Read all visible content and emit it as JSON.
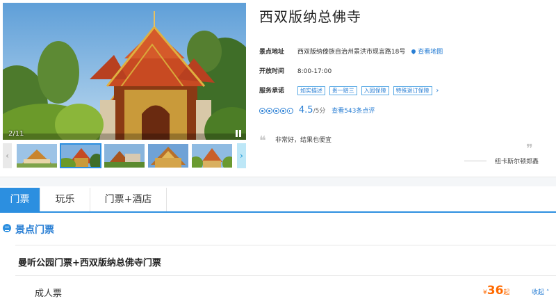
{
  "gallery": {
    "counter": "2/11",
    "thumb_prev": "‹",
    "thumb_next": "›"
  },
  "attraction": {
    "title": "西双版纳总佛寺",
    "address_label": "景点地址",
    "address": "西双版纳傣族自治州景洪市现言路18号",
    "map_link": "查看地图",
    "hours_label": "开放时间",
    "hours": "8:00-17:00",
    "service_label": "服务承诺",
    "service_tags": [
      "如实描述",
      "贵一赔三",
      "入园保障",
      "特殊退订保障"
    ],
    "service_more": "›",
    "score": "4.5",
    "score_max": "/5分",
    "reviews_link": "查看543条点评",
    "quote_open": "❝",
    "quote_text": "非常好，结果也便宜",
    "quote_close": "❞",
    "quote_author": "纽卡斯尔顿郑鑫"
  },
  "tabs": [
    {
      "label": "门票",
      "active": true
    },
    {
      "label": "玩乐",
      "active": false
    },
    {
      "label": "门票+酒店",
      "active": false
    }
  ],
  "tickets": {
    "section_title": "景点门票",
    "package_title": "曼听公园门票+西双版纳总佛寺门票",
    "rows": [
      {
        "label": "成人票",
        "currency": "¥",
        "price": "36",
        "suffix": "起",
        "toggle": "收起"
      }
    ]
  },
  "colors": {
    "accent": "#2c8fe0",
    "price": "#ff6a00",
    "link": "#2a7fd4"
  }
}
